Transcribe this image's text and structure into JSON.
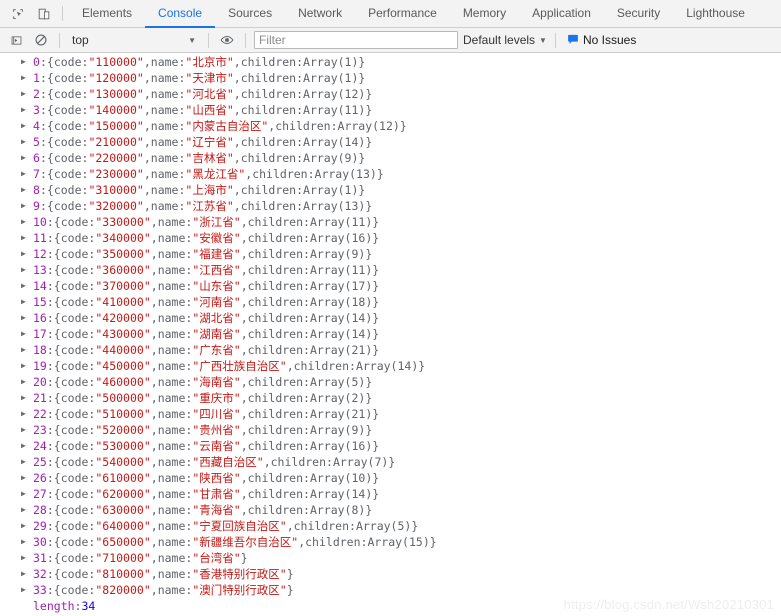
{
  "devtools": {
    "icons": {
      "inspect": "inspect-element-icon",
      "device": "device-toolbar-icon"
    },
    "tabs": [
      {
        "label": "Elements",
        "active": false
      },
      {
        "label": "Console",
        "active": true
      },
      {
        "label": "Sources",
        "active": false
      },
      {
        "label": "Network",
        "active": false
      },
      {
        "label": "Performance",
        "active": false
      },
      {
        "label": "Memory",
        "active": false
      },
      {
        "label": "Application",
        "active": false
      },
      {
        "label": "Security",
        "active": false
      },
      {
        "label": "Lighthouse",
        "active": false
      }
    ]
  },
  "console_toolbar": {
    "execute_icon": "execution-context-icon",
    "clear_icon": "clear-console-icon",
    "context": "top",
    "context_caret": "▼",
    "eye_icon": "live-expression-icon",
    "filter_placeholder": "Filter",
    "filter_value": "",
    "levels_label": "Default levels",
    "levels_caret": "▼",
    "issues_icon": "issues-icon",
    "issues_label": "No Issues"
  },
  "console_output": {
    "entries": [
      {
        "index": "0",
        "code": "110000",
        "name": "北京市",
        "children": "1"
      },
      {
        "index": "1",
        "code": "120000",
        "name": "天津市",
        "children": "1"
      },
      {
        "index": "2",
        "code": "130000",
        "name": "河北省",
        "children": "12"
      },
      {
        "index": "3",
        "code": "140000",
        "name": "山西省",
        "children": "11"
      },
      {
        "index": "4",
        "code": "150000",
        "name": "内蒙古自治区",
        "children": "12"
      },
      {
        "index": "5",
        "code": "210000",
        "name": "辽宁省",
        "children": "14"
      },
      {
        "index": "6",
        "code": "220000",
        "name": "吉林省",
        "children": "9"
      },
      {
        "index": "7",
        "code": "230000",
        "name": "黑龙江省",
        "children": "13"
      },
      {
        "index": "8",
        "code": "310000",
        "name": "上海市",
        "children": "1"
      },
      {
        "index": "9",
        "code": "320000",
        "name": "江苏省",
        "children": "13"
      },
      {
        "index": "10",
        "code": "330000",
        "name": "浙江省",
        "children": "11"
      },
      {
        "index": "11",
        "code": "340000",
        "name": "安徽省",
        "children": "16"
      },
      {
        "index": "12",
        "code": "350000",
        "name": "福建省",
        "children": "9"
      },
      {
        "index": "13",
        "code": "360000",
        "name": "江西省",
        "children": "11"
      },
      {
        "index": "14",
        "code": "370000",
        "name": "山东省",
        "children": "17"
      },
      {
        "index": "15",
        "code": "410000",
        "name": "河南省",
        "children": "18"
      },
      {
        "index": "16",
        "code": "420000",
        "name": "湖北省",
        "children": "14"
      },
      {
        "index": "17",
        "code": "430000",
        "name": "湖南省",
        "children": "14"
      },
      {
        "index": "18",
        "code": "440000",
        "name": "广东省",
        "children": "21"
      },
      {
        "index": "19",
        "code": "450000",
        "name": "广西壮族自治区",
        "children": "14"
      },
      {
        "index": "20",
        "code": "460000",
        "name": "海南省",
        "children": "5"
      },
      {
        "index": "21",
        "code": "500000",
        "name": "重庆市",
        "children": "2"
      },
      {
        "index": "22",
        "code": "510000",
        "name": "四川省",
        "children": "21"
      },
      {
        "index": "23",
        "code": "520000",
        "name": "贵州省",
        "children": "9"
      },
      {
        "index": "24",
        "code": "530000",
        "name": "云南省",
        "children": "16"
      },
      {
        "index": "25",
        "code": "540000",
        "name": "西藏自治区",
        "children": "7"
      },
      {
        "index": "26",
        "code": "610000",
        "name": "陕西省",
        "children": "10"
      },
      {
        "index": "27",
        "code": "620000",
        "name": "甘肃省",
        "children": "14"
      },
      {
        "index": "28",
        "code": "630000",
        "name": "青海省",
        "children": "8"
      },
      {
        "index": "29",
        "code": "640000",
        "name": "宁夏回族自治区",
        "children": "5"
      },
      {
        "index": "30",
        "code": "650000",
        "name": "新疆维吾尔自治区",
        "children": "15"
      },
      {
        "index": "31",
        "code": "710000",
        "name": "台湾省",
        "children": null
      },
      {
        "index": "32",
        "code": "810000",
        "name": "香港特别行政区",
        "children": null
      },
      {
        "index": "33",
        "code": "820000",
        "name": "澳门特别行政区",
        "children": null
      }
    ],
    "length_key": "length",
    "length_value": "34",
    "tokens": {
      "arrow": "▶",
      "colon": ": ",
      "open_brace": "{",
      "close_brace": "}",
      "code_key": "code",
      "name_key": "name",
      "children_key": "children",
      "quote": "\"",
      "comma": ", ",
      "array": "Array"
    }
  },
  "watermark": {
    "text": "https://blog.csdn.net/Wsh20210301"
  },
  "colors": {
    "accent": "#1a73e8",
    "string": "#c41a16",
    "index": "#a020b0",
    "number": "#1c00cf",
    "toolbar_bg": "#f3f3f3"
  }
}
